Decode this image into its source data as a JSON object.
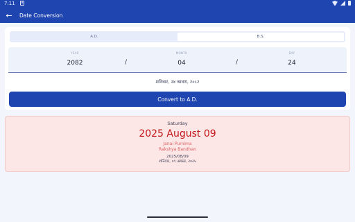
{
  "status": {
    "time": "7:11",
    "notif_glyph": "a"
  },
  "appbar": {
    "title": "Date Conversion"
  },
  "tabs": [
    {
      "label": "A.D."
    },
    {
      "label": "B.S."
    }
  ],
  "fields": {
    "year": {
      "label": "YEAR",
      "value": "2082"
    },
    "month": {
      "label": "MONTH",
      "value": "04"
    },
    "day": {
      "label": "DAY",
      "value": "24"
    },
    "separator": "/"
  },
  "nepali_date_line": "शनिवार, २४ श्रावण, २०८२",
  "convert_button": "Convert to A.D.",
  "result": {
    "weekday": "Saturday",
    "date": "2025 August 09",
    "events": [
      "Janai Purnima",
      "Rakshya Bandhan"
    ],
    "numeric": "2025/08/09",
    "nepali": "शनिवार, ०९ अगस्त, २०२५"
  },
  "colors": {
    "primary": "#1e45b0",
    "background": "#f2f5fb",
    "result_bg": "#fde6e6",
    "result_date": "#c0161a",
    "event_text": "#db5f5f"
  },
  "icons": {
    "back": "arrow-left-icon"
  }
}
